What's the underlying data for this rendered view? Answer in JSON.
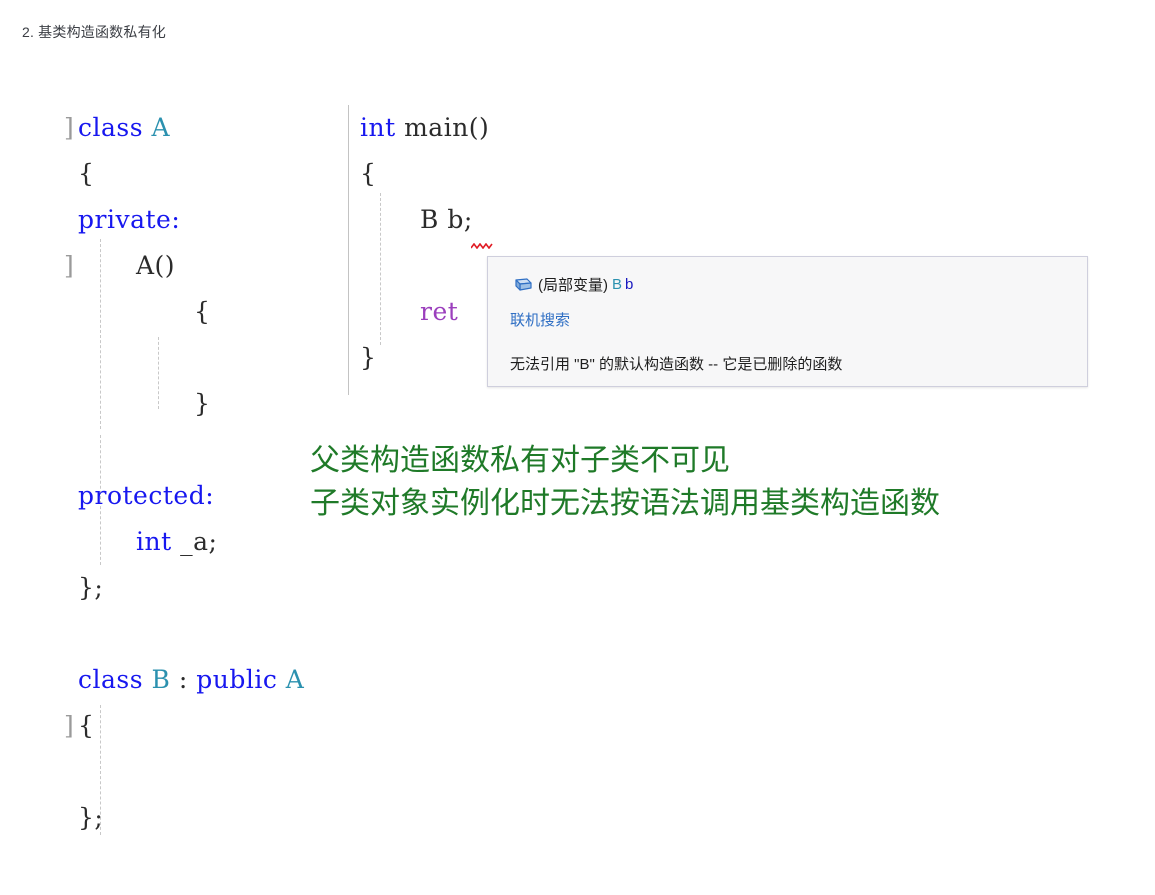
{
  "heading": "2. 基类构造函数私有化",
  "code": {
    "left_pane": [
      {
        "indent": 0,
        "tokens": [
          {
            "t": "class ",
            "c": "kw"
          },
          {
            "t": "A",
            "c": "type"
          }
        ]
      },
      {
        "indent": 0,
        "tokens": [
          {
            "t": "{",
            "c": "plain"
          }
        ]
      },
      {
        "indent": 0,
        "tokens": [
          {
            "t": "private:",
            "c": "kw"
          }
        ]
      },
      {
        "indent": 1,
        "tokens": [
          {
            "t": "A()",
            "c": "plain"
          }
        ]
      },
      {
        "indent": 2,
        "tokens": [
          {
            "t": "{",
            "c": "plain"
          }
        ]
      },
      {
        "indent": 2,
        "tokens": []
      },
      {
        "indent": 2,
        "tokens": [
          {
            "t": "}",
            "c": "plain"
          }
        ]
      },
      {
        "indent": 0,
        "tokens": []
      },
      {
        "indent": 0,
        "tokens": [
          {
            "t": "protected:",
            "c": "kw"
          }
        ]
      },
      {
        "indent": 1,
        "tokens": [
          {
            "t": "int ",
            "c": "kw"
          },
          {
            "t": "_a;",
            "c": "plain"
          }
        ]
      },
      {
        "indent": 0,
        "tokens": [
          {
            "t": "};",
            "c": "plain"
          }
        ]
      },
      {
        "indent": 0,
        "tokens": []
      },
      {
        "indent": 0,
        "tokens": [
          {
            "t": "class ",
            "c": "kw"
          },
          {
            "t": "B",
            "c": "type"
          },
          {
            "t": " : ",
            "c": "plain"
          },
          {
            "t": "public ",
            "c": "kw"
          },
          {
            "t": "A",
            "c": "type"
          }
        ]
      },
      {
        "indent": 0,
        "tokens": [
          {
            "t": "{",
            "c": "plain"
          }
        ]
      },
      {
        "indent": 0,
        "tokens": []
      },
      {
        "indent": 0,
        "tokens": [
          {
            "t": "};",
            "c": "plain"
          }
        ]
      }
    ],
    "right_pane": [
      {
        "indent": 0,
        "tokens": [
          {
            "t": "int ",
            "c": "kw"
          },
          {
            "t": "main()",
            "c": "fn"
          }
        ]
      },
      {
        "indent": 0,
        "tokens": [
          {
            "t": "{",
            "c": "plain"
          }
        ]
      },
      {
        "indent": 1,
        "tokens": [
          {
            "t": "B b;",
            "c": "plain"
          }
        ]
      },
      {
        "indent": 1,
        "tokens": []
      },
      {
        "indent": 1,
        "tokens": [
          {
            "t": "ret",
            "c": "ctrl"
          }
        ]
      },
      {
        "indent": 0,
        "tokens": [
          {
            "t": "}",
            "c": "plain"
          }
        ]
      }
    ],
    "collapse_markers": [
      "]",
      "]",
      "]"
    ]
  },
  "tooltip": {
    "icon": "local-variable-box-icon",
    "signature_prefix": "(局部变量)",
    "signature_type": "B",
    "signature_name": "b",
    "search_link": "联机搜索",
    "error": "无法引用 \"B\" 的默认构造函数 -- 它是已删除的函数"
  },
  "annotation": {
    "line1": "父类构造函数私有对子类不可见",
    "line2": "子类对象实例化时无法按语法调用基类构造函数",
    "color": "#1f7a28"
  },
  "colors": {
    "keyword": "#1717ef",
    "type": "#2b91af",
    "control": "#9b3fbd",
    "plain": "#2b2b2b",
    "squiggle": "#e01b24",
    "tooltip_bg": "#f7f7f8",
    "tooltip_border": "#cfcfdd",
    "link": "#2f6fc4"
  }
}
